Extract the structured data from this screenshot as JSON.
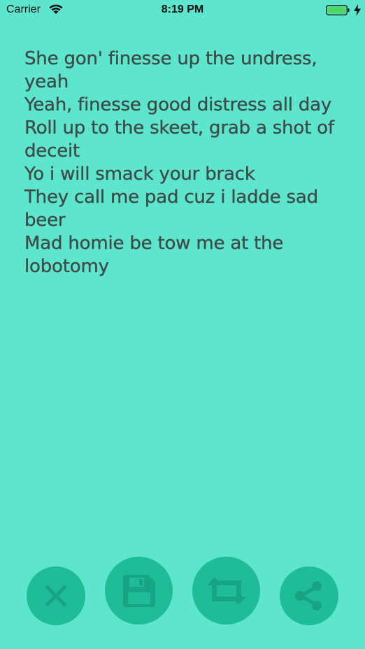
{
  "status_bar": {
    "carrier": "Carrier",
    "time": "8:19 PM",
    "icons": [
      "wifi-icon",
      "battery-icon",
      "charging-icon"
    ]
  },
  "lyrics": {
    "lines": [
      "She gon' finesse up the undress, yeah",
      "Yeah, finesse good distress all day",
      "Roll up to the skeet, grab a shot of deceit",
      "Yo i will smack your brack",
      "They call me pad cuz i ladde sad beer",
      "Mad homie be tow me at the lobotomy"
    ]
  },
  "actions": {
    "icons": [
      "close-icon",
      "save-icon",
      "repeat-icon",
      "share-icon"
    ]
  },
  "colors": {
    "background": "#5de6cd",
    "button": "#1fbc98",
    "icon": "#17a483",
    "text": "#3e4b49"
  }
}
